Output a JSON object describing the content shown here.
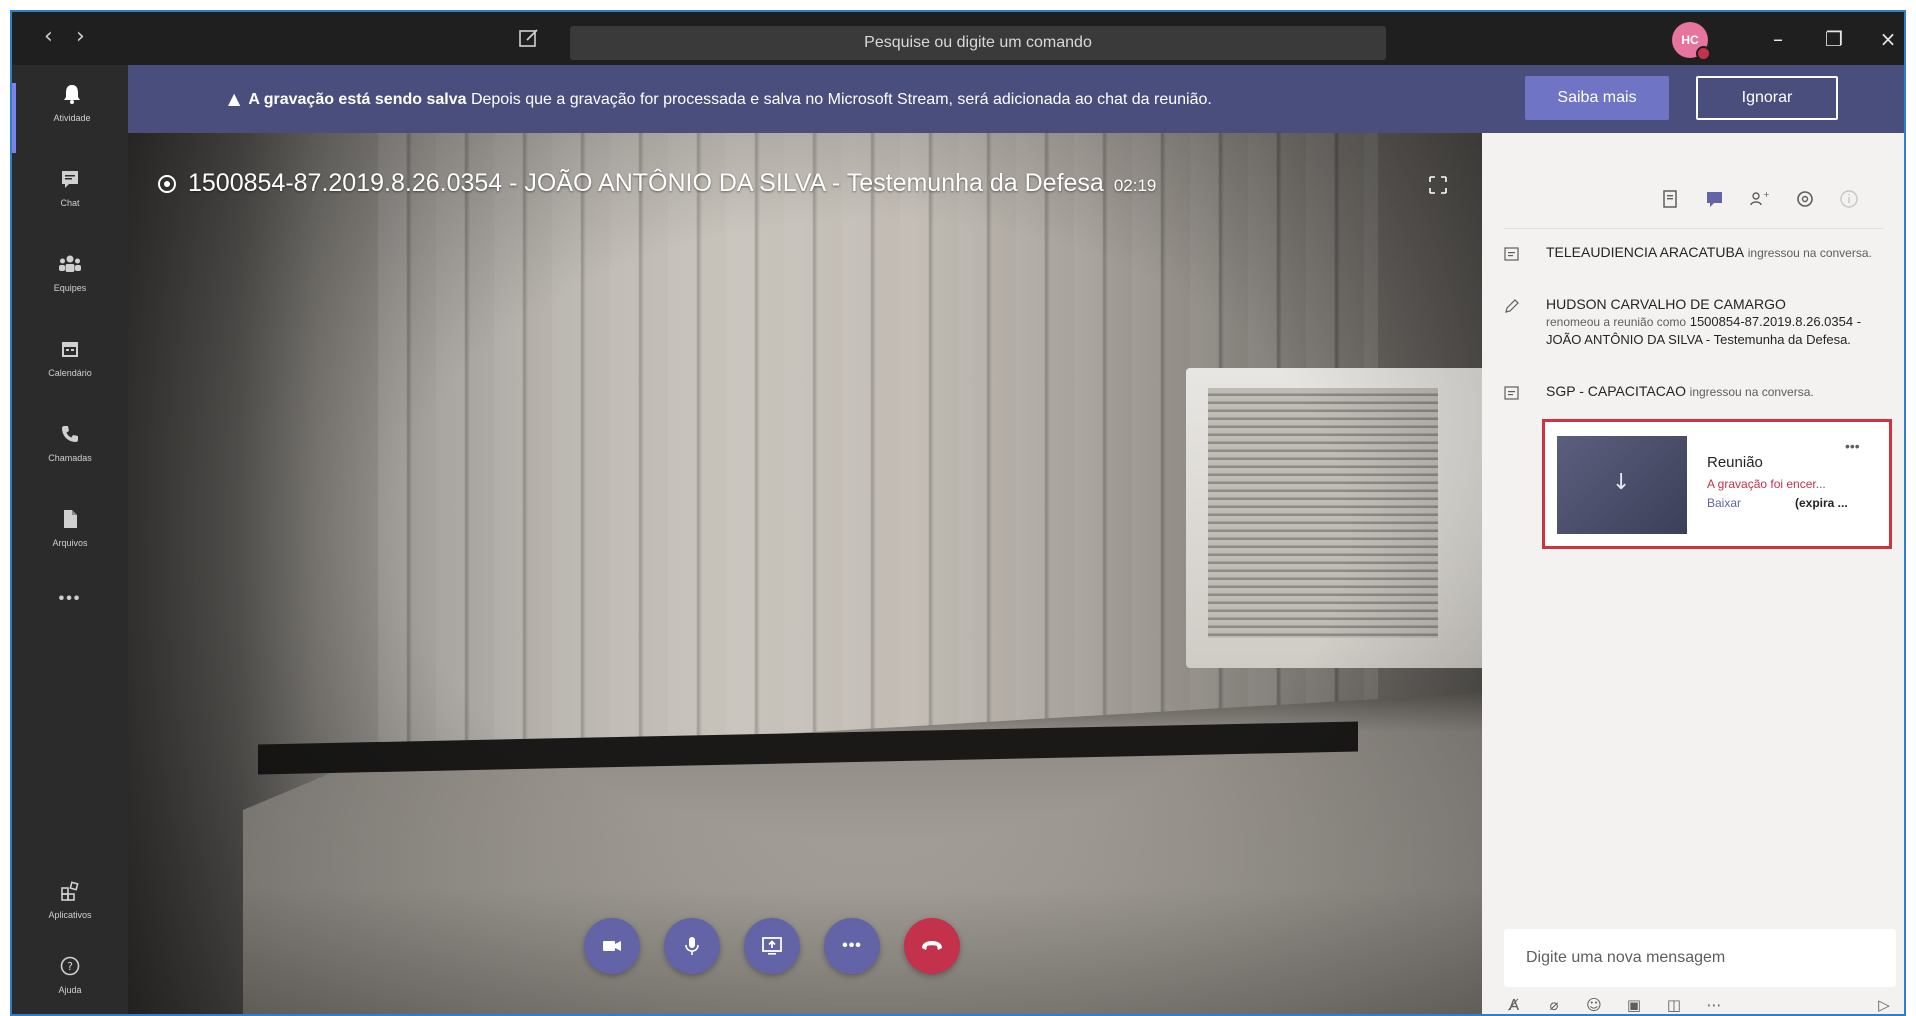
{
  "titlebar": {
    "back_label": "‹",
    "forward_label": "›",
    "search_placeholder": "Pesquise ou digite um comando",
    "avatar_initials": "HC",
    "minimize_label": "–",
    "maximize_label": "❐",
    "close_label": "×"
  },
  "rail": {
    "items": [
      {
        "label": "Atividade",
        "icon": "bell-icon",
        "active": true
      },
      {
        "label": "Chat",
        "icon": "chat-icon",
        "active": false
      },
      {
        "label": "Equipes",
        "icon": "teams-icon",
        "active": false
      },
      {
        "label": "Calendário",
        "icon": "calendar-icon",
        "active": false
      },
      {
        "label": "Chamadas",
        "icon": "phone-icon",
        "active": false
      },
      {
        "label": "Arquivos",
        "icon": "file-icon",
        "active": false
      }
    ],
    "more_label": "•••",
    "apps_label": "Aplicativos",
    "help_label": "Ajuda"
  },
  "banner": {
    "bold": "A gravação está sendo salva",
    "text": "Depois que a gravação for processada e salva no Microsoft Stream, será adicionada ao chat da reunião.",
    "learn_more": "Saiba mais",
    "ignore": "Ignorar"
  },
  "meeting": {
    "title": "1500854-87.2019.8.26.0354 - JOÃO ANTÔNIO DA SILVA - Testemunha da Defesa",
    "timer": "02:19"
  },
  "chat_events": [
    {
      "name": "TELEAUDIENCIA ARACATUBA",
      "action": "ingressou na conversa."
    },
    {
      "name": "HUDSON CARVALHO DE CAMARGO",
      "action": "renomeou a reunião como",
      "detail": "1500854-87.2019.8.26.0354 - JOÃO ANTÔNIO DA SILVA - Testemunha da Defesa."
    },
    {
      "name": "SGP - CAPACITACAO",
      "action": "ingressou na conversa."
    }
  ],
  "recording_card": {
    "title": "Reunião",
    "status": "A gravação foi encer...",
    "download": "Baixar",
    "expires": "(expira ...",
    "more": "•••"
  },
  "compose": {
    "placeholder": "Digite uma nova mensagem"
  },
  "colors": {
    "accent": "#6264a7",
    "banner_bg": "#4a4e7d",
    "hangup": "#c4314b",
    "highlight_border": "#d1323f"
  }
}
